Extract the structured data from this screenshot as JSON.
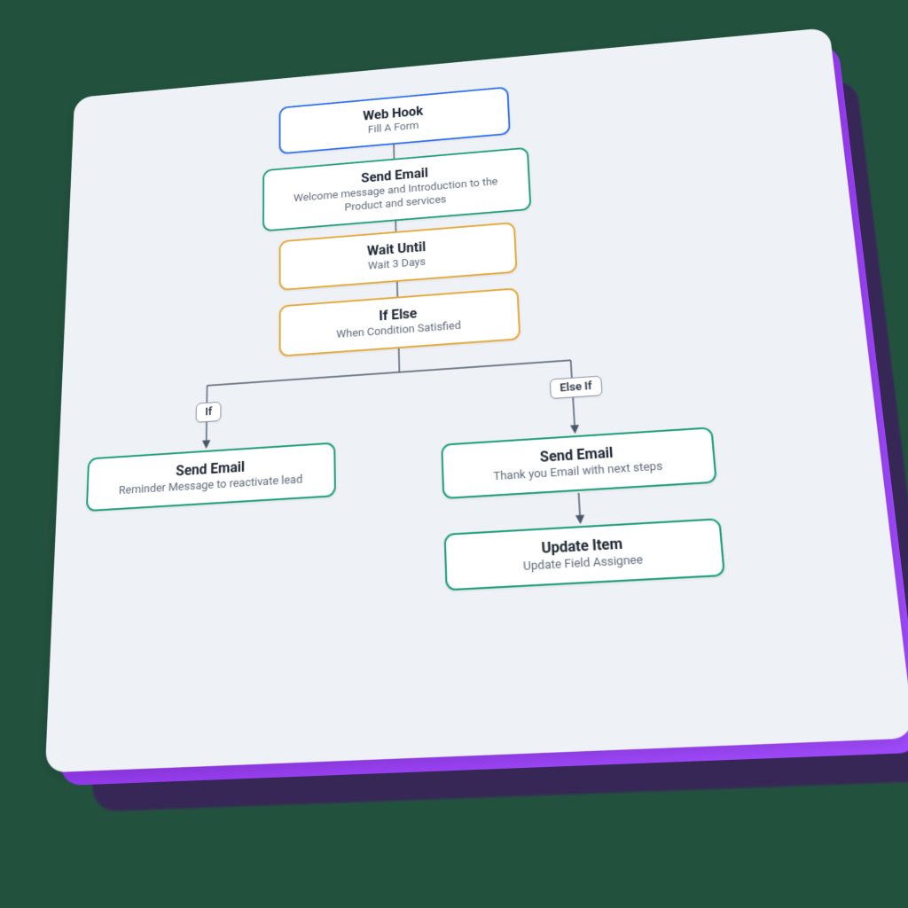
{
  "colors": {
    "background": "#22523e",
    "panel": "#eef1f6",
    "slab_accent_start": "#8a2be2",
    "slab_accent_end": "#a24bff",
    "shadow": "#3a1e5a",
    "border_blue": "#2e6ff2",
    "border_teal": "#1f9e7a",
    "border_amber": "#e6a83a",
    "connector": "#4a5565"
  },
  "branches": {
    "if": "If",
    "else_if": "Else If"
  },
  "nodes": {
    "webhook": {
      "title": "Web Hook",
      "subtitle": "Fill A Form",
      "border": "blue"
    },
    "email1": {
      "title": "Send Email",
      "subtitle": "Welcome message and Introduction to the Product and services",
      "border": "teal"
    },
    "wait": {
      "title": "Wait Until",
      "subtitle": "Wait 3 Days",
      "border": "amber"
    },
    "ifelse": {
      "title": "If Else",
      "subtitle": "When Condition Satisfied",
      "border": "amber"
    },
    "email_if": {
      "title": "Send Email",
      "subtitle": "Reminder Message to reactivate lead",
      "border": "teal"
    },
    "email_elif": {
      "title": "Send Email",
      "subtitle": "Thank you Email with next steps",
      "border": "teal"
    },
    "update": {
      "title": "Update Item",
      "subtitle": "Update Field Assignee",
      "border": "teal"
    }
  }
}
